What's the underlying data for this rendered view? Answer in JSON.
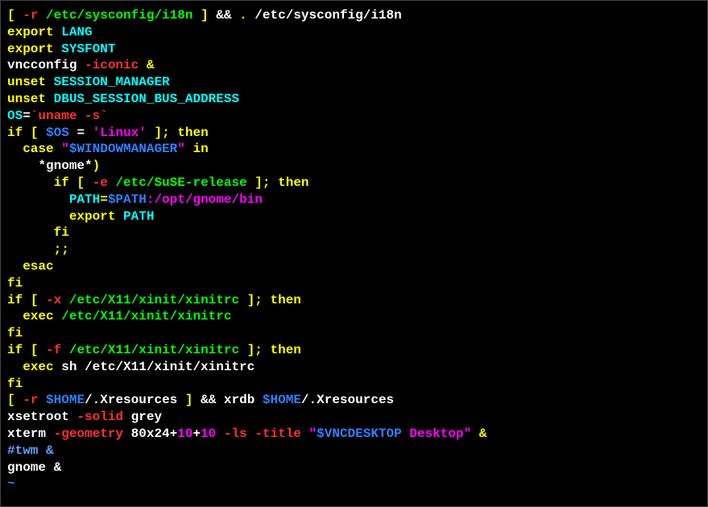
{
  "tokens": [
    {
      "id": "t1",
      "class": "yellow",
      "text": "["
    },
    {
      "id": "t2",
      "class": "white",
      "text": " "
    },
    {
      "id": "t3",
      "class": "red",
      "text": "-r"
    },
    {
      "id": "t4",
      "class": "white",
      "text": " "
    },
    {
      "id": "t5",
      "class": "green",
      "text": "/etc/sysconfig/i18n"
    },
    {
      "id": "t6",
      "class": "white",
      "text": " "
    },
    {
      "id": "t7",
      "class": "yellow",
      "text": "]"
    },
    {
      "id": "t8",
      "class": "white",
      "text": " && "
    },
    {
      "id": "t9",
      "class": "yellow",
      "text": "."
    },
    {
      "id": "t10",
      "class": "white",
      "text": " /etc/sysconfig/i18n\n"
    },
    {
      "id": "t11",
      "class": "yellow",
      "text": "export"
    },
    {
      "id": "t12",
      "class": "white",
      "text": " "
    },
    {
      "id": "t13",
      "class": "cyan",
      "text": "LANG"
    },
    {
      "id": "t14",
      "class": "white",
      "text": "\n"
    },
    {
      "id": "t15",
      "class": "yellow",
      "text": "export"
    },
    {
      "id": "t16",
      "class": "white",
      "text": " "
    },
    {
      "id": "t17",
      "class": "cyan",
      "text": "SYSFONT"
    },
    {
      "id": "t18",
      "class": "white",
      "text": "\nvncconfig "
    },
    {
      "id": "t19",
      "class": "red",
      "text": "-iconic"
    },
    {
      "id": "t20",
      "class": "white",
      "text": " "
    },
    {
      "id": "t21",
      "class": "yellow",
      "text": "&"
    },
    {
      "id": "t22",
      "class": "white",
      "text": "\n"
    },
    {
      "id": "t23",
      "class": "yellow",
      "text": "unset"
    },
    {
      "id": "t24",
      "class": "white",
      "text": " "
    },
    {
      "id": "t25",
      "class": "cyan",
      "text": "SESSION_MANAGER"
    },
    {
      "id": "t26",
      "class": "white",
      "text": "\n"
    },
    {
      "id": "t27",
      "class": "yellow",
      "text": "unset"
    },
    {
      "id": "t28",
      "class": "white",
      "text": " "
    },
    {
      "id": "t29",
      "class": "cyan",
      "text": "DBUS_SESSION_BUS_ADDRESS"
    },
    {
      "id": "t30",
      "class": "white",
      "text": "\n"
    },
    {
      "id": "t31",
      "class": "cyan",
      "text": "OS"
    },
    {
      "id": "t32",
      "class": "white",
      "text": "="
    },
    {
      "id": "t33",
      "class": "red",
      "text": "`uname -s`"
    },
    {
      "id": "t34",
      "class": "white",
      "text": "\n"
    },
    {
      "id": "t35",
      "class": "yellow",
      "text": "if"
    },
    {
      "id": "t36",
      "class": "white",
      "text": " "
    },
    {
      "id": "t37",
      "class": "yellow",
      "text": "["
    },
    {
      "id": "t38",
      "class": "white",
      "text": " "
    },
    {
      "id": "t39",
      "class": "blue",
      "text": "$OS"
    },
    {
      "id": "t40",
      "class": "white",
      "text": " = "
    },
    {
      "id": "t41",
      "class": "magenta",
      "text": "'Linux'"
    },
    {
      "id": "t42",
      "class": "white",
      "text": " "
    },
    {
      "id": "t43",
      "class": "yellow",
      "text": "];"
    },
    {
      "id": "t44",
      "class": "white",
      "text": " "
    },
    {
      "id": "t45",
      "class": "yellow",
      "text": "then"
    },
    {
      "id": "t46",
      "class": "white",
      "text": "\n  "
    },
    {
      "id": "t47",
      "class": "yellow",
      "text": "case"
    },
    {
      "id": "t48",
      "class": "white",
      "text": " "
    },
    {
      "id": "t49",
      "class": "magenta",
      "text": "\""
    },
    {
      "id": "t50",
      "class": "blue",
      "text": "$WINDOWMANAGER"
    },
    {
      "id": "t51",
      "class": "magenta",
      "text": "\""
    },
    {
      "id": "t52",
      "class": "white",
      "text": " "
    },
    {
      "id": "t53",
      "class": "yellow",
      "text": "in"
    },
    {
      "id": "t54",
      "class": "white",
      "text": "\n    *gnome*"
    },
    {
      "id": "t55",
      "class": "yellow",
      "text": ")"
    },
    {
      "id": "t56",
      "class": "white",
      "text": "\n      "
    },
    {
      "id": "t57",
      "class": "yellow",
      "text": "if"
    },
    {
      "id": "t58",
      "class": "white",
      "text": " "
    },
    {
      "id": "t59",
      "class": "yellow",
      "text": "["
    },
    {
      "id": "t60",
      "class": "white",
      "text": " "
    },
    {
      "id": "t61",
      "class": "red",
      "text": "-e"
    },
    {
      "id": "t62",
      "class": "white",
      "text": " "
    },
    {
      "id": "t63",
      "class": "green",
      "text": "/etc/SuSE-release"
    },
    {
      "id": "t64",
      "class": "white",
      "text": " "
    },
    {
      "id": "t65",
      "class": "yellow",
      "text": "];"
    },
    {
      "id": "t66",
      "class": "white",
      "text": " "
    },
    {
      "id": "t67",
      "class": "yellow",
      "text": "then"
    },
    {
      "id": "t68",
      "class": "white",
      "text": "\n        "
    },
    {
      "id": "t69",
      "class": "cyan",
      "text": "PATH"
    },
    {
      "id": "t70",
      "class": "yellow",
      "text": "="
    },
    {
      "id": "t71",
      "class": "blue",
      "text": "$PATH"
    },
    {
      "id": "t72",
      "class": "magenta",
      "text": ":/opt/gnome/bin"
    },
    {
      "id": "t73",
      "class": "white",
      "text": "\n        "
    },
    {
      "id": "t74",
      "class": "yellow",
      "text": "export"
    },
    {
      "id": "t75",
      "class": "white",
      "text": " "
    },
    {
      "id": "t76",
      "class": "cyan",
      "text": "PATH"
    },
    {
      "id": "t77",
      "class": "white",
      "text": "\n      "
    },
    {
      "id": "t78",
      "class": "yellow",
      "text": "fi"
    },
    {
      "id": "t79",
      "class": "white",
      "text": "\n      "
    },
    {
      "id": "t80",
      "class": "yellow",
      "text": ";;"
    },
    {
      "id": "t81",
      "class": "white",
      "text": "\n  "
    },
    {
      "id": "t82",
      "class": "yellow",
      "text": "esac"
    },
    {
      "id": "t83",
      "class": "white",
      "text": "\n"
    },
    {
      "id": "t84",
      "class": "yellow",
      "text": "fi"
    },
    {
      "id": "t85",
      "class": "white",
      "text": "\n"
    },
    {
      "id": "t86",
      "class": "yellow",
      "text": "if"
    },
    {
      "id": "t87",
      "class": "white",
      "text": " "
    },
    {
      "id": "t88",
      "class": "yellow",
      "text": "["
    },
    {
      "id": "t89",
      "class": "white",
      "text": " "
    },
    {
      "id": "t90",
      "class": "red",
      "text": "-x"
    },
    {
      "id": "t91",
      "class": "white",
      "text": " "
    },
    {
      "id": "t92",
      "class": "green",
      "text": "/etc/X11/xinit/xinitrc"
    },
    {
      "id": "t93",
      "class": "white",
      "text": " "
    },
    {
      "id": "t94",
      "class": "yellow",
      "text": "];"
    },
    {
      "id": "t95",
      "class": "white",
      "text": " "
    },
    {
      "id": "t96",
      "class": "yellow",
      "text": "then"
    },
    {
      "id": "t97",
      "class": "white",
      "text": "\n  "
    },
    {
      "id": "t98",
      "class": "yellow",
      "text": "exec"
    },
    {
      "id": "t99",
      "class": "white",
      "text": " "
    },
    {
      "id": "t100",
      "class": "green",
      "text": "/etc/X11/xinit/xinitrc"
    },
    {
      "id": "t101",
      "class": "white",
      "text": "\n"
    },
    {
      "id": "t102",
      "class": "yellow",
      "text": "fi"
    },
    {
      "id": "t103",
      "class": "white",
      "text": "\n"
    },
    {
      "id": "t104",
      "class": "yellow",
      "text": "if"
    },
    {
      "id": "t105",
      "class": "white",
      "text": " "
    },
    {
      "id": "t106",
      "class": "yellow",
      "text": "["
    },
    {
      "id": "t107",
      "class": "white",
      "text": " "
    },
    {
      "id": "t108",
      "class": "red",
      "text": "-f"
    },
    {
      "id": "t109",
      "class": "white",
      "text": " "
    },
    {
      "id": "t110",
      "class": "green",
      "text": "/etc/X11/xinit/xinitrc"
    },
    {
      "id": "t111",
      "class": "white",
      "text": " "
    },
    {
      "id": "t112",
      "class": "yellow",
      "text": "];"
    },
    {
      "id": "t113",
      "class": "white",
      "text": " "
    },
    {
      "id": "t114",
      "class": "yellow",
      "text": "then"
    },
    {
      "id": "t115",
      "class": "white",
      "text": "\n  "
    },
    {
      "id": "t116",
      "class": "yellow",
      "text": "exec"
    },
    {
      "id": "t117",
      "class": "white",
      "text": " sh /etc/X11/xinit/xinitrc\n"
    },
    {
      "id": "t118",
      "class": "yellow",
      "text": "fi"
    },
    {
      "id": "t119",
      "class": "white",
      "text": "\n"
    },
    {
      "id": "t120",
      "class": "yellow",
      "text": "["
    },
    {
      "id": "t121",
      "class": "white",
      "text": " "
    },
    {
      "id": "t122",
      "class": "red",
      "text": "-r"
    },
    {
      "id": "t123",
      "class": "white",
      "text": " "
    },
    {
      "id": "t124",
      "class": "blue",
      "text": "$HOME"
    },
    {
      "id": "t125",
      "class": "white",
      "text": "/.Xresources "
    },
    {
      "id": "t126",
      "class": "yellow",
      "text": "]"
    },
    {
      "id": "t127",
      "class": "white",
      "text": " && xrdb "
    },
    {
      "id": "t128",
      "class": "blue",
      "text": "$HOME"
    },
    {
      "id": "t129",
      "class": "white",
      "text": "/.Xresources\nxsetroot "
    },
    {
      "id": "t130",
      "class": "red",
      "text": "-solid"
    },
    {
      "id": "t131",
      "class": "white",
      "text": " grey\nxterm "
    },
    {
      "id": "t132",
      "class": "red",
      "text": "-geometry"
    },
    {
      "id": "t133",
      "class": "white",
      "text": " 80x24+"
    },
    {
      "id": "t134",
      "class": "magenta",
      "text": "10"
    },
    {
      "id": "t135",
      "class": "white",
      "text": "+"
    },
    {
      "id": "t136",
      "class": "magenta",
      "text": "10"
    },
    {
      "id": "t137",
      "class": "white",
      "text": " "
    },
    {
      "id": "t138",
      "class": "red",
      "text": "-ls"
    },
    {
      "id": "t139",
      "class": "white",
      "text": " "
    },
    {
      "id": "t140",
      "class": "red",
      "text": "-title"
    },
    {
      "id": "t141",
      "class": "white",
      "text": " "
    },
    {
      "id": "t142",
      "class": "magenta",
      "text": "\""
    },
    {
      "id": "t143",
      "class": "blue",
      "text": "$VNCDESKTOP"
    },
    {
      "id": "t144",
      "class": "magenta",
      "text": " Desktop\""
    },
    {
      "id": "t145",
      "class": "white",
      "text": " "
    },
    {
      "id": "t146",
      "class": "yellow",
      "text": "&"
    },
    {
      "id": "t147",
      "class": "white",
      "text": "\n"
    },
    {
      "id": "t148",
      "class": "lightblue",
      "text": "#twm &"
    },
    {
      "id": "t149",
      "class": "white",
      "text": "\ngnome &\n"
    },
    {
      "id": "t150",
      "class": "blue",
      "text": "~"
    }
  ]
}
